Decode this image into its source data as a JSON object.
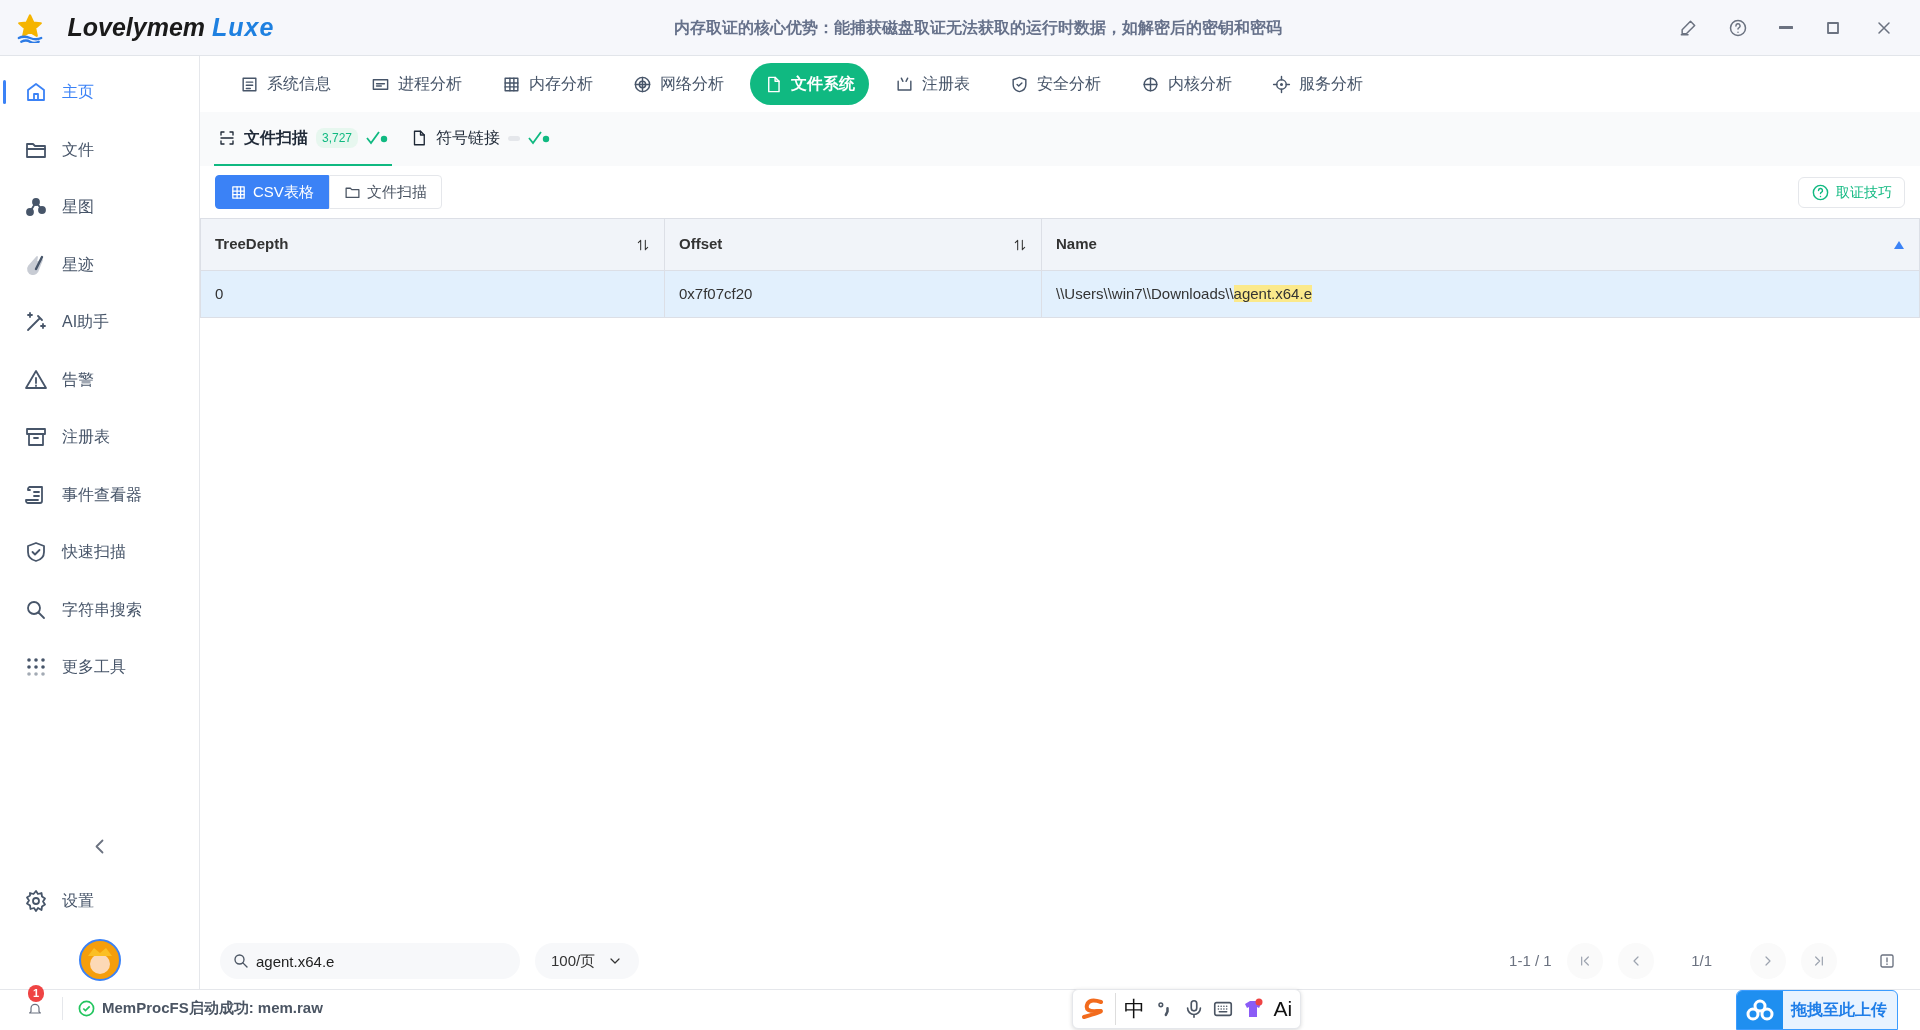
{
  "window": {
    "logo_name": "Lovelymem",
    "logo_accent": "Luxe",
    "tagline": "内存取证的核心优势：能捕获磁盘取证无法获取的运行时数据，如解密后的密钥和密码"
  },
  "sidebar": {
    "items": [
      {
        "label": "主页",
        "selected": true
      },
      {
        "label": "文件",
        "selected": false
      },
      {
        "label": "星图",
        "selected": false
      },
      {
        "label": "星迹",
        "selected": false
      },
      {
        "label": "AI助手",
        "selected": false
      },
      {
        "label": "告警",
        "selected": false
      },
      {
        "label": "注册表",
        "selected": false
      },
      {
        "label": "事件查看器",
        "selected": false
      },
      {
        "label": "快速扫描",
        "selected": false
      },
      {
        "label": "字符串搜索",
        "selected": false
      },
      {
        "label": "更多工具",
        "selected": false
      }
    ],
    "settings": "设置"
  },
  "tabs": [
    {
      "label": "系统信息",
      "selected": false
    },
    {
      "label": "进程分析",
      "selected": false
    },
    {
      "label": "内存分析",
      "selected": false
    },
    {
      "label": "网络分析",
      "selected": false
    },
    {
      "label": "文件系统",
      "selected": true
    },
    {
      "label": "注册表",
      "selected": false
    },
    {
      "label": "安全分析",
      "selected": false
    },
    {
      "label": "内核分析",
      "selected": false
    },
    {
      "label": "服务分析",
      "selected": false
    }
  ],
  "subtabs": [
    {
      "label": "文件扫描",
      "selected": true,
      "count": "3,727",
      "done": true
    },
    {
      "label": "符号链接",
      "selected": false,
      "pending": true,
      "done": true
    }
  ],
  "views": [
    {
      "label": "CSV表格",
      "selected": true
    },
    {
      "label": "文件扫描",
      "selected": false
    }
  ],
  "tips_button": "取证技巧",
  "table": {
    "columns": [
      {
        "label": "TreeDepth",
        "sorted": false
      },
      {
        "label": "Offset",
        "sorted": false
      },
      {
        "label": "Name",
        "sorted": true
      }
    ],
    "rows": [
      {
        "selected": true,
        "tree_depth": "0",
        "offset": "0x7f07cf20",
        "name_prefix": "\\\\Users\\\\win7\\\\Downloads\\\\",
        "name_match": "agent.x64.e"
      }
    ]
  },
  "footer": {
    "search_value": "agent.x64.e",
    "page_size": "100/页",
    "range": "1-1 / 1",
    "page": "1/1"
  },
  "status_bar": {
    "notifications": "1",
    "message": "MemProcFS启动成功: mem.raw",
    "upload": "拖拽至此上传"
  },
  "ime_toolbar": {
    "mode": "中",
    "ai": "Ai"
  }
}
